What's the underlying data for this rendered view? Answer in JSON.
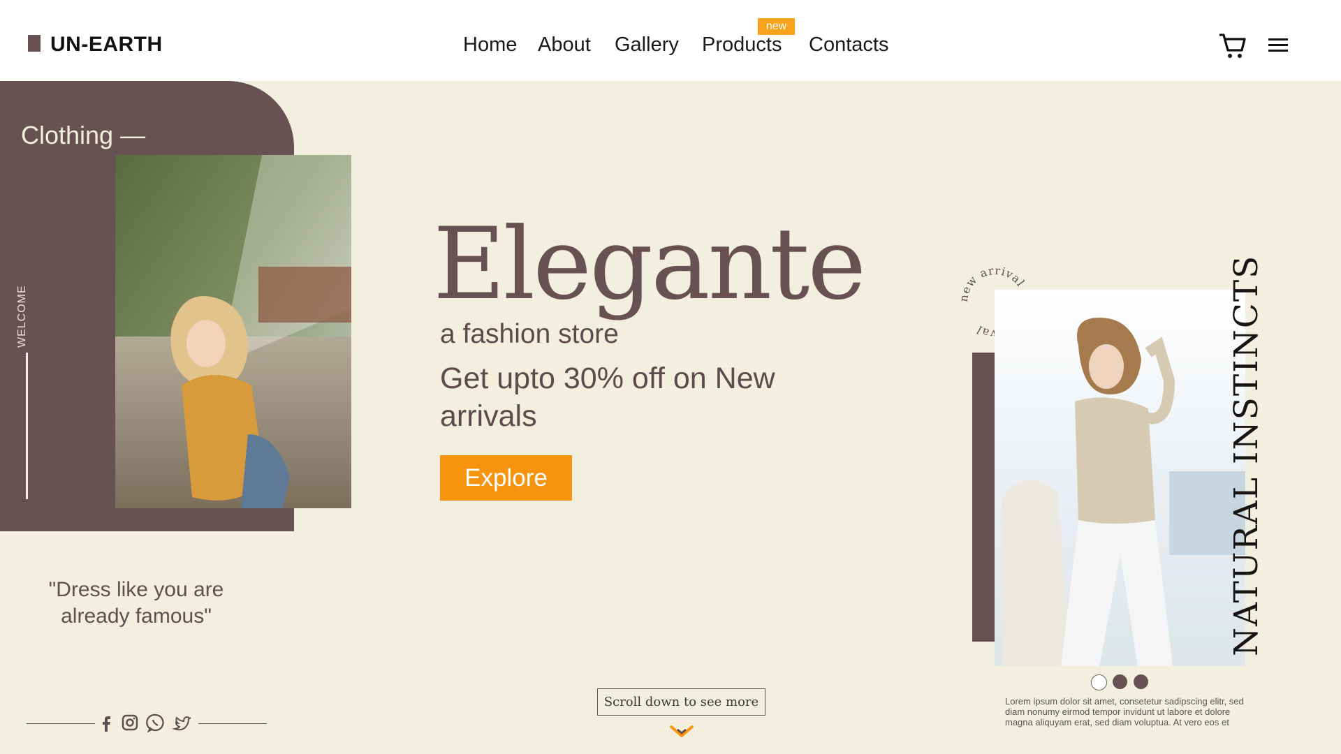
{
  "brand": {
    "name": "UN-EARTH"
  },
  "nav": {
    "items": [
      {
        "label": "Home"
      },
      {
        "label": "About"
      },
      {
        "label": "Gallery"
      },
      {
        "label": "Products",
        "badge": "new"
      },
      {
        "label": "Contacts"
      }
    ]
  },
  "icons": {
    "cart": "cart-icon",
    "menu": "hamburger-menu-icon",
    "facebook": "facebook-icon",
    "instagram": "instagram-icon",
    "whatsapp": "whatsapp-icon",
    "twitter": "twitter-icon",
    "scroll": "chevron-down-icon"
  },
  "colors": {
    "background": "#f2efde",
    "brand_brown": "#675153",
    "accent_orange": "#f7940f",
    "badge_orange": "#f7a21b"
  },
  "left_panel": {
    "label": "Clothing —",
    "vertical_label": "WELCOME"
  },
  "hero": {
    "title": "Elegante",
    "subtitle": "a fashion store",
    "offer": "Get upto 30% off on New arrivals",
    "cta": "Explore"
  },
  "quote": "\"Dress like you are already famous\"",
  "scroll_hint": "Scroll down to see more",
  "right_panel": {
    "circle_text": "new arrival new arrival",
    "vertical_text": "NATURAL INSTINCTS",
    "carousel": {
      "total": 3,
      "active": 1
    },
    "lorem": "Lorem ipsum dolor sit amet, consetetur sadipscing elitr, sed diam nonumy eirmod tempor invidunt ut labore et dolore magna aliquyam erat, sed diam voluptua. At vero eos et"
  }
}
